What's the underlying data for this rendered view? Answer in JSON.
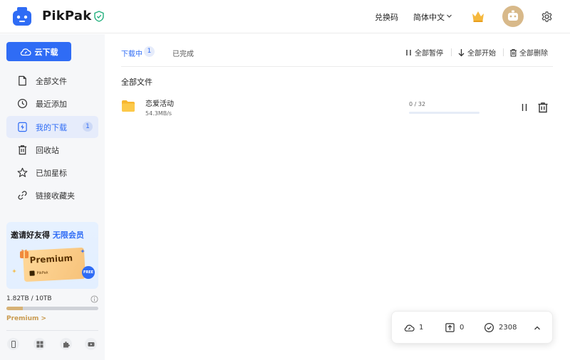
{
  "header": {
    "brand": "PikPak",
    "redeem_label": "兑换码",
    "language_label": "简体中文",
    "icons": [
      "pikpak-logo-icon",
      "verified-shield-icon",
      "chevron-down-icon",
      "crown-icon",
      "avatar",
      "settings-gear-icon"
    ],
    "colors": {
      "accent": "#2f6cf5",
      "crown": "#f5b83d",
      "avatar_bg": "#d8b98a"
    }
  },
  "sidebar": {
    "cloud_download_label": "云下载",
    "items": [
      {
        "label": "全部文件",
        "icon": "file-icon",
        "active": false
      },
      {
        "label": "最近添加",
        "icon": "clock-icon",
        "active": false
      },
      {
        "label": "我的下载",
        "icon": "download-lightning-icon",
        "active": true,
        "badge": "1"
      },
      {
        "label": "回收站",
        "icon": "trash-icon",
        "active": false
      },
      {
        "label": "已加星标",
        "icon": "star-icon",
        "active": false
      },
      {
        "label": "链接收藏夹",
        "icon": "link-icon",
        "active": false
      }
    ],
    "promo": {
      "title_prefix": "邀请好友得",
      "title_highlight": "无限会员",
      "card_title": "Premium",
      "card_brand": "PikPak",
      "free_badge": "FREE"
    },
    "storage": {
      "text": "1.82TB / 10TB",
      "used_fraction": 0.182,
      "premium_label": "Premium",
      "premium_chevron": ">"
    },
    "platforms": [
      "phone-icon",
      "windows-icon",
      "extension-puzzle-icon",
      "youtube-icon"
    ]
  },
  "main": {
    "tabs": {
      "downloading_label": "下载中",
      "downloading_count": "1",
      "completed_label": "已完成"
    },
    "actions": {
      "pause_all": "全部暂停",
      "start_all": "全部开始",
      "delete_all": "全部删除"
    },
    "section_title": "全部文件",
    "files": [
      {
        "name": "恋爱活动",
        "speed": "54.3MB/s",
        "progress_text": "0 / 32",
        "progress_fraction": 0.0,
        "icon": "folder-icon"
      }
    ]
  },
  "status_bar": {
    "downloading": "1",
    "uploading": "0",
    "completed": "2308"
  }
}
